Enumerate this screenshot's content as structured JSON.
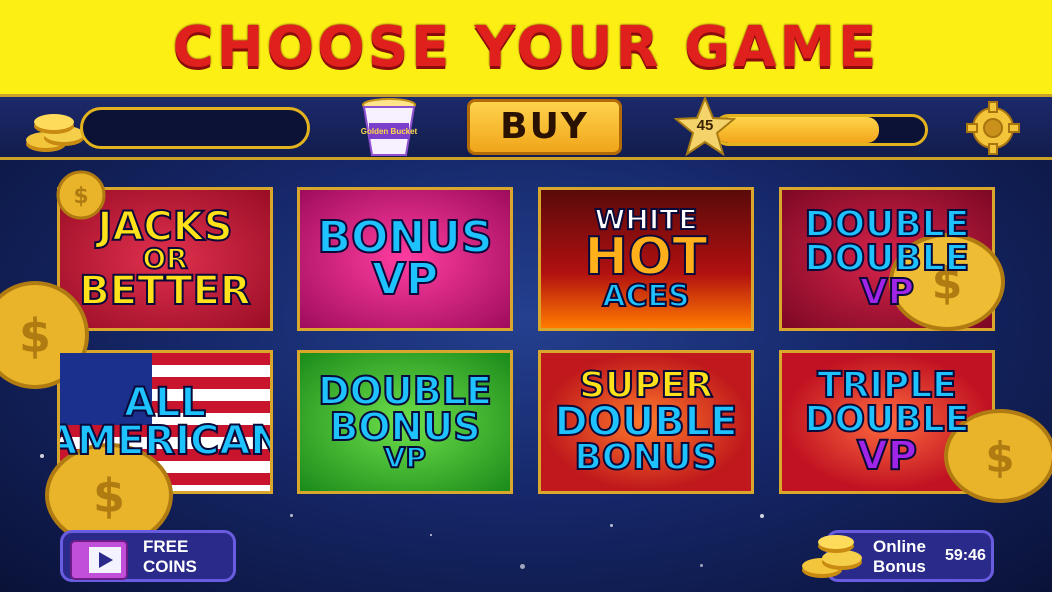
{
  "header": {
    "title": "CHOOSE YOUR GAME"
  },
  "topbar": {
    "buy_label": "BUY",
    "noodle_cup_text": "Golden Bucket",
    "level": "45",
    "xp_fraction": 0.78
  },
  "games": [
    {
      "lines": [
        "JACKS",
        "OR",
        "BETTER"
      ]
    },
    {
      "lines": [
        "BONUS",
        "VP"
      ]
    },
    {
      "lines": [
        "WHITE",
        "HOT",
        "ACES"
      ]
    },
    {
      "lines": [
        "DOUBLE",
        "DOUBLE",
        "VP"
      ]
    },
    {
      "lines": [
        "ALL",
        "AMERICAN"
      ]
    },
    {
      "lines": [
        "DOUBLE",
        "BONUS",
        "VP"
      ]
    },
    {
      "lines": [
        "SUPER",
        "DOUBLE",
        "BONUS"
      ]
    },
    {
      "lines": [
        "TRIPLE",
        "DOUBLE",
        "VP"
      ]
    }
  ],
  "bottom": {
    "free_coins_line1": "FREE",
    "free_coins_line2": "COINS",
    "online_bonus_line1": "Online",
    "online_bonus_line2": "Bonus",
    "online_bonus_timer": "59:46"
  },
  "colors": {
    "banner_bg": "#fbef14",
    "banner_text": "#e0201c",
    "gold_border": "#d9a72b",
    "stage_bg": "#16286b"
  },
  "icons": [
    "coin-stack-icon",
    "noodle-cup-icon",
    "level-star-icon",
    "gear-icon",
    "tv-icon",
    "gold-coin-icon"
  ]
}
